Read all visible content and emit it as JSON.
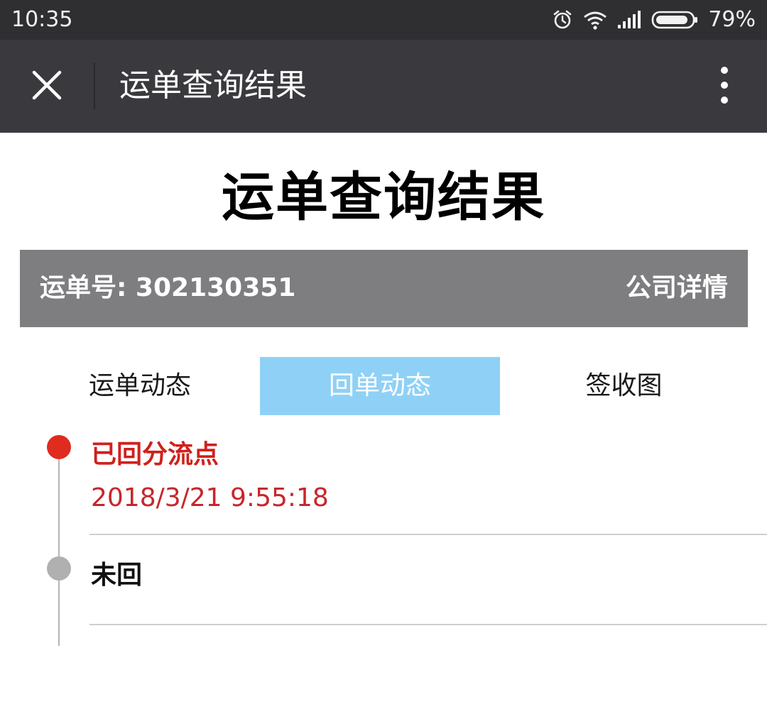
{
  "status_bar": {
    "time": "10:35",
    "battery_percent": "79%",
    "icons": [
      "alarm-icon",
      "wifi-icon",
      "signal-icon",
      "battery-icon"
    ]
  },
  "title_bar": {
    "title": "运单查询结果",
    "close_icon": "close-icon",
    "more_icon": "more-vertical-icon"
  },
  "page": {
    "heading": "运单查询结果",
    "waybill_label": "运单号: 302130351",
    "company_details": "公司详情"
  },
  "tabs": [
    {
      "label": "运单动态",
      "active": false
    },
    {
      "label": "回单动态",
      "active": true
    },
    {
      "label": "签收图",
      "active": false
    }
  ],
  "timeline": [
    {
      "status": "已回分流点",
      "time": "2018/3/21 9:55:18",
      "color": "#d0201c"
    },
    {
      "status": "未回",
      "color": "#111111"
    }
  ],
  "colors": {
    "status_bar_bg": "#2f2f32",
    "title_bar_bg": "#3a3a3e",
    "waybill_bar_bg": "#7e7d80",
    "active_tab_bg": "#8fd1f6",
    "accent_red": "#e02b1f",
    "inactive_dot": "#b0b0b0"
  }
}
